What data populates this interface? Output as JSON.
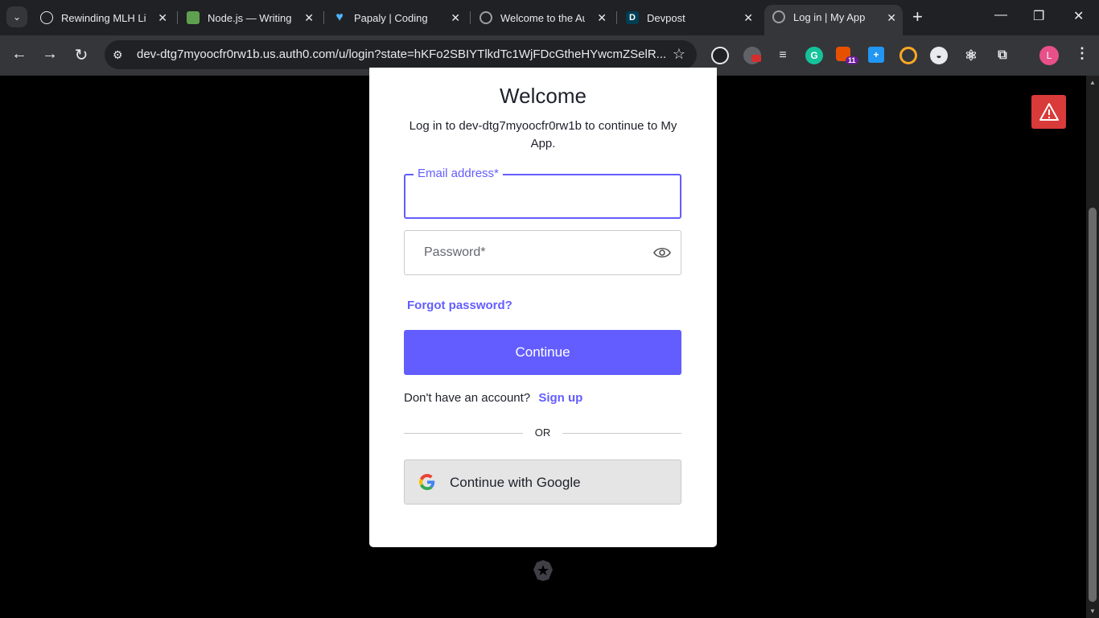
{
  "browser": {
    "tabs": [
      {
        "title": "Rewinding MLH Live",
        "favicon_color": "#e8eaed"
      },
      {
        "title": "Node.js — Writing f",
        "favicon_color": "#5fa04e"
      },
      {
        "title": "Papaly | Coding",
        "favicon_color": "#4fb3f6"
      },
      {
        "title": "Welcome to the Aut",
        "favicon_color": "#9aa0a6"
      },
      {
        "title": "Devpost",
        "favicon_color": "#003e54",
        "favicon_letter": "D"
      },
      {
        "title": "Log in | My App",
        "favicon_color": "#9aa0a6",
        "active": true
      }
    ],
    "url": "dev-dtg7myoocfr0rw1b.us.auth0.com/u/login?state=hKFo2SBIYTlkdTc1WjFDcGtheHYwcmZSelR...",
    "extension_badge": "11",
    "profile_initial": "L"
  },
  "login": {
    "heading": "Welcome",
    "subtitle": "Log in to dev-dtg7myoocfr0rw1b to continue to My App.",
    "email_label": "Email address*",
    "password_placeholder": "Password*",
    "forgot_password": "Forgot password?",
    "continue_label": "Continue",
    "no_account_text": "Don't have an account?",
    "signup_label": "Sign up",
    "divider_text": "OR",
    "google_label": "Continue with Google"
  },
  "colors": {
    "accent": "#635dff",
    "warning": "#d93a3a"
  }
}
